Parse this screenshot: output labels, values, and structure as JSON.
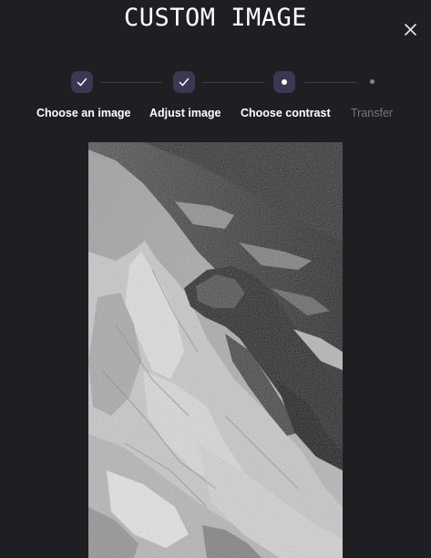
{
  "dialog": {
    "title": "CUSTOM IMAGE"
  },
  "steps": [
    {
      "label": "Choose an image",
      "state": "completed"
    },
    {
      "label": "Adjust image",
      "state": "completed"
    },
    {
      "label": "Choose contrast",
      "state": "current"
    },
    {
      "label": "Transfer",
      "state": "upcoming"
    }
  ],
  "colors": {
    "background": "#1e1f22",
    "step_circle": "#3a3852",
    "text_active": "#ffffff",
    "text_inactive": "#77787d"
  },
  "preview": {
    "content": "grayscale-photo",
    "filter": "high-contrast-black-and-white"
  }
}
